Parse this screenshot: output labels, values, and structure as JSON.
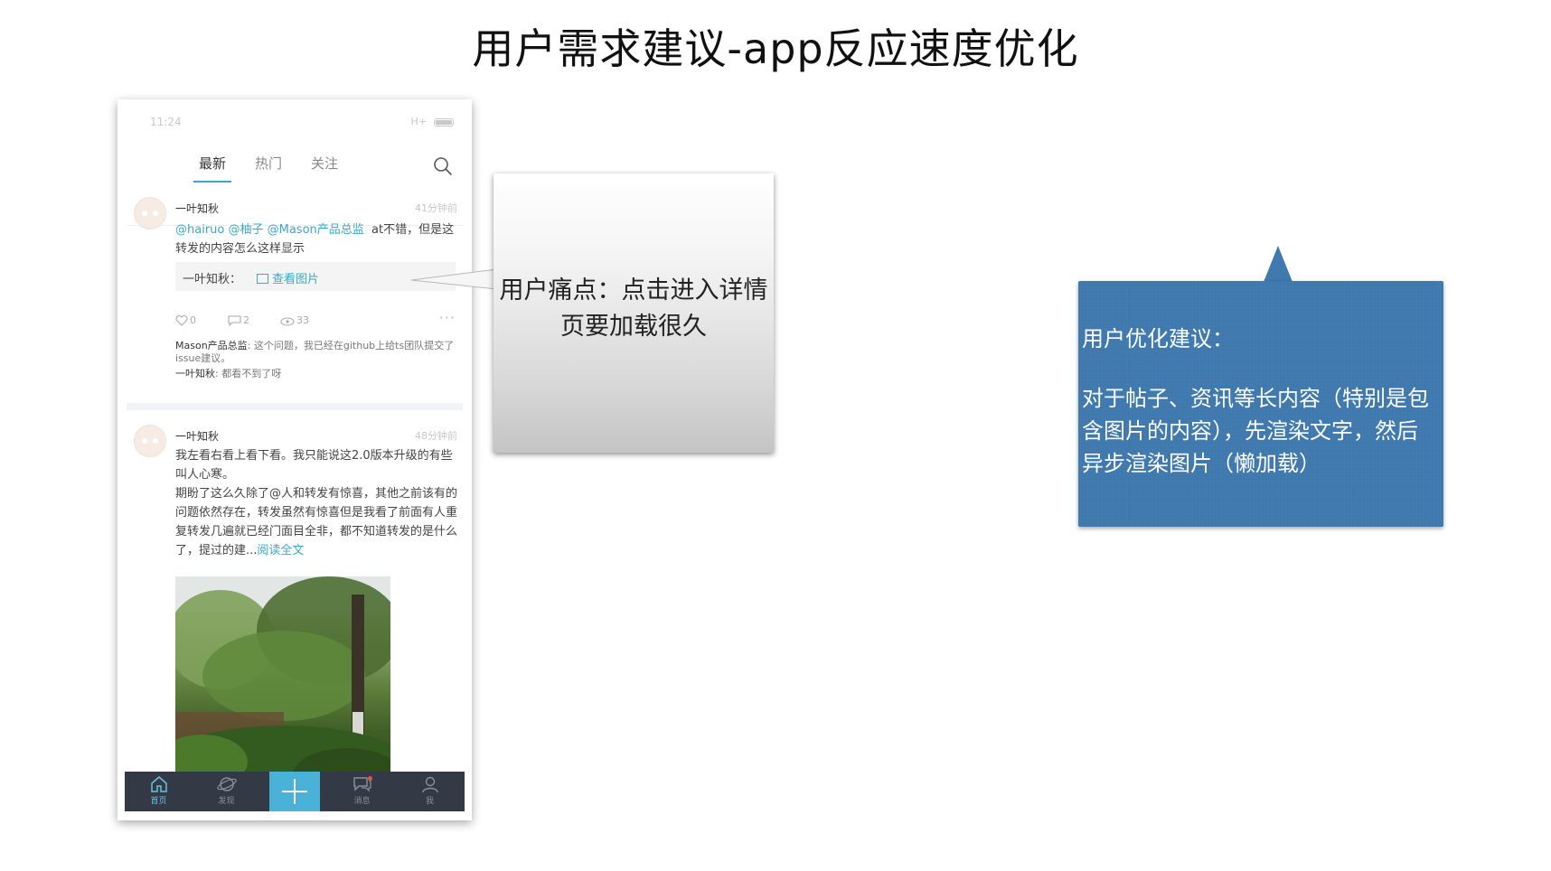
{
  "slide": {
    "title": "用户需求建议-app反应速度优化"
  },
  "phone": {
    "status": {
      "time": "11:24",
      "network": "H+"
    },
    "tabs": [
      {
        "label": "最新",
        "active": true
      },
      {
        "label": "热门",
        "active": false
      },
      {
        "label": "关注",
        "active": false
      }
    ],
    "posts": [
      {
        "username": "一叶知秋",
        "time": "41分钟前",
        "mentions": "@hairuo @柚子 @Mason产品总监",
        "text_tail": "at不错，但是这",
        "text_line2": "转发的内容怎么这样显示",
        "forward_name": "一叶知秋：",
        "forward_link": "查看图片",
        "likes": "0",
        "comments_count": "2",
        "views": "33",
        "comment1_name": "Mason产品总监",
        "comment1_text": ": 这个问题，我已经在github上给ts团队提交了issue建议。",
        "comment2_name": "一叶知秋",
        "comment2_text": ": 都看不到了呀"
      },
      {
        "username": "一叶知秋",
        "time": "48分钟前",
        "text_p1": "我左看右看上看下看。我只能说这2.0版本升级的有些叫人心寒。",
        "text_p2": "期盼了这么久除了@人和转发有惊喜，其他之前该有的问题依然存在，转发虽然有惊喜但是我看了前面有人重复转发几遍就已经门面目全非，都不知道转发的是什么了，提过的建...",
        "read_more": "阅读全文"
      }
    ],
    "nav": [
      {
        "label": "首页",
        "icon": "home-icon",
        "active": true
      },
      {
        "label": "发现",
        "icon": "discover-icon",
        "active": false
      },
      {
        "label": "消息",
        "icon": "message-icon",
        "active": false
      },
      {
        "label": "我",
        "icon": "profile-icon",
        "active": false
      }
    ]
  },
  "pain": {
    "text": "用户痛点：点击进入详情页要加载很久"
  },
  "suggestion": {
    "title": "用户优化建议：",
    "body": "对于帖子、资讯等长内容（特别是包含图片的内容），先渲染文字，然后异步渲染图片（懒加载）"
  },
  "colors": {
    "accent": "#3aa9c8",
    "nav_bg": "#343a45",
    "suggestion_bg": "#3f79ad"
  }
}
